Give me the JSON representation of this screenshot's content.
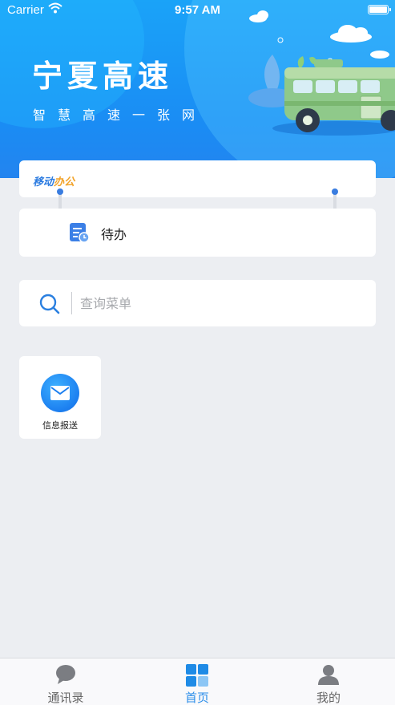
{
  "status_bar": {
    "carrier": "Carrier",
    "time": "9:57 AM"
  },
  "banner": {
    "title": "宁夏高速",
    "subtitle": "智慧高速一张网"
  },
  "mobile_office": {
    "logo_text_main": "移动",
    "logo_text_accent": "办公"
  },
  "todo": {
    "label": "待办",
    "icon": "todo-document-icon"
  },
  "search": {
    "placeholder": "查询菜单",
    "value": "",
    "icon": "search-icon"
  },
  "apps": [
    {
      "label": "信息报送",
      "icon": "mail-icon"
    }
  ],
  "tabbar": {
    "tabs": [
      {
        "label": "通讯录",
        "icon": "chat-bubble-icon",
        "active": false
      },
      {
        "label": "首页",
        "icon": "grid-icon",
        "active": true
      },
      {
        "label": "我的",
        "icon": "person-icon",
        "active": false
      }
    ]
  },
  "colors": {
    "brand_blue": "#1a8cf4",
    "accent_orange": "#f2a32a",
    "active_tab": "#2a8de9",
    "background": "#eceef2"
  }
}
